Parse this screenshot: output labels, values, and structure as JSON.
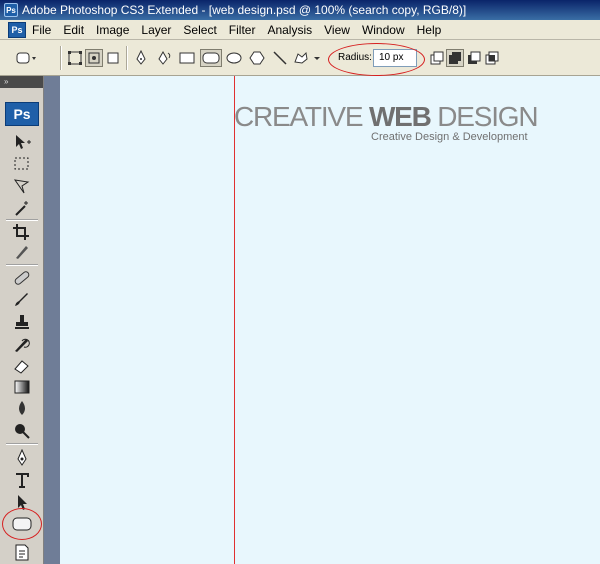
{
  "window": {
    "title": "Adobe Photoshop CS3 Extended - [web design.psd @ 100% (search copy, RGB/8)]",
    "app_icon": "Ps"
  },
  "menu": {
    "items": [
      {
        "label": "File"
      },
      {
        "label": "Edit"
      },
      {
        "label": "Image"
      },
      {
        "label": "Layer"
      },
      {
        "label": "Select"
      },
      {
        "label": "Filter"
      },
      {
        "label": "Analysis"
      },
      {
        "label": "View"
      },
      {
        "label": "Window"
      },
      {
        "label": "Help"
      }
    ]
  },
  "options": {
    "radius_label": "Radius:",
    "radius_value": "10 px"
  },
  "toolbox": {
    "logo": "Ps",
    "header_glyph": "»",
    "tools": [
      "move-tool-icon",
      "marquee-tool-icon",
      "lasso-tool-icon",
      "magic-wand-icon",
      "crop-tool-icon",
      "slice-tool-icon",
      "healing-brush-icon",
      "brush-tool-icon",
      "clone-stamp-icon",
      "history-brush-icon",
      "eraser-tool-icon",
      "gradient-tool-icon",
      "blur-tool-icon",
      "dodge-tool-icon",
      "pen-tool-icon",
      "type-tool-icon",
      "path-selection-icon",
      "rounded-rectangle-tool-icon",
      "notes-tool-icon"
    ]
  },
  "canvas": {
    "logo_light": "CREATIVE ",
    "logo_bold": "WEB",
    "logo_tail": " DESIGN",
    "tagline": "Creative Design & Development",
    "background": "#e8f7fd",
    "guide_color": "#e03030"
  },
  "colors": {
    "highlight_ellipse": "#d62020"
  }
}
